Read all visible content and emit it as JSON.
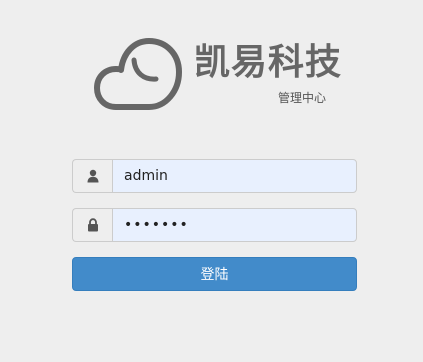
{
  "brand": {
    "name": "凯易科技",
    "subtitle": "管理中心"
  },
  "form": {
    "username": {
      "icon": "user-icon",
      "value": "admin"
    },
    "password": {
      "icon": "lock-icon",
      "value": "•••••••"
    },
    "submit_label": "登陆"
  },
  "colors": {
    "background": "#eeeeee",
    "brand_text": "#666666",
    "input_fill": "#e8f0fe",
    "button": "#428bca"
  }
}
